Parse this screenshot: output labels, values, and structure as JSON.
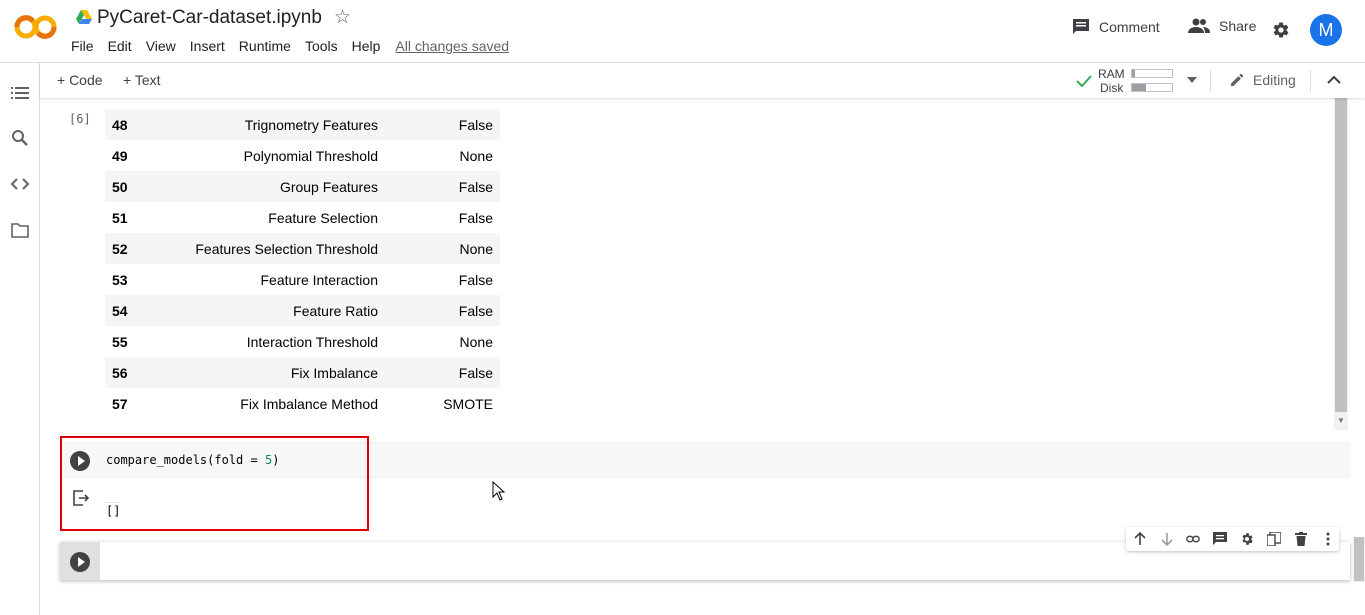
{
  "header": {
    "title": "PyCaret-Car-dataset.ipynb",
    "menu": [
      "File",
      "Edit",
      "View",
      "Insert",
      "Runtime",
      "Tools",
      "Help"
    ],
    "save_status": "All changes saved",
    "comment_label": "Comment",
    "share_label": "Share",
    "avatar_letter": "M"
  },
  "toolbar": {
    "add_code": "+ Code",
    "add_text": "+ Text",
    "ram_label": "RAM",
    "disk_label": "Disk",
    "editing_label": "Editing"
  },
  "cell6": {
    "exec_count": "[6]",
    "rows": [
      {
        "idx": "48",
        "desc": "Trignometry Features",
        "val": "False"
      },
      {
        "idx": "49",
        "desc": "Polynomial Threshold",
        "val": "None"
      },
      {
        "idx": "50",
        "desc": "Group Features",
        "val": "False"
      },
      {
        "idx": "51",
        "desc": "Feature Selection",
        "val": "False"
      },
      {
        "idx": "52",
        "desc": "Features Selection Threshold",
        "val": "None"
      },
      {
        "idx": "53",
        "desc": "Feature Interaction",
        "val": "False"
      },
      {
        "idx": "54",
        "desc": "Feature Ratio",
        "val": "False"
      },
      {
        "idx": "55",
        "desc": "Interaction Threshold",
        "val": "None"
      },
      {
        "idx": "56",
        "desc": "Fix Imbalance",
        "val": "False"
      },
      {
        "idx": "57",
        "desc": "Fix Imbalance Method",
        "val": "SMOTE"
      }
    ]
  },
  "cell_compare": {
    "code_prefix": "compare_models(fold = ",
    "code_number": "5",
    "code_suffix": ")",
    "output": "[]"
  },
  "colors": {
    "accent": "#1a73e8",
    "highlight": "#e00000",
    "success": "#34a853"
  }
}
